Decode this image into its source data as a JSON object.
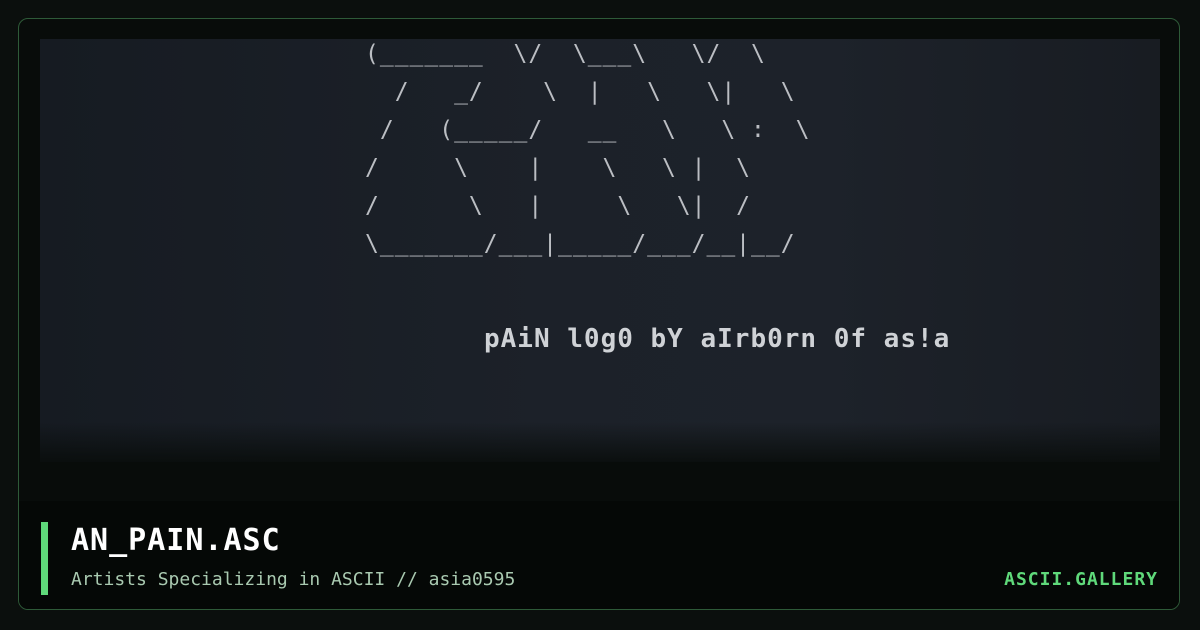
{
  "preview": {
    "ascii_art": "(_______  \\/  \\___\\   \\/  \\\n  /   _/    \\  |   \\   \\|   \\\n /   (_____/   __   \\   \\ :  \\\n/     \\    |    \\   \\ |  \\\n/      \\   |     \\   \\|  /\n\\_______/___|_____/___/__|__/",
    "caption": "pAiN l0g0 bY aIrb0rn 0f as!a"
  },
  "footer": {
    "title": "AN_PAIN.ASC",
    "subtitle": "Artists Specializing in ASCII // asia0595",
    "brand": "ASCII.GALLERY"
  },
  "colors": {
    "accent": "#5fd97a",
    "border": "#2e5a38",
    "background": "#080c0a"
  }
}
